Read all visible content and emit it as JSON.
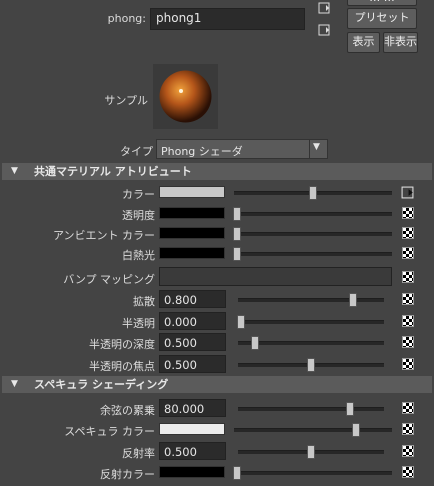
{
  "header": {
    "node_label": "phong:",
    "node_name": "phong1",
    "preset_button": "プリセット",
    "top_button_partial": "… …",
    "show_button": "表示",
    "hide_button": "非表示"
  },
  "sample": {
    "label": "サンプル"
  },
  "type": {
    "label": "タイプ",
    "value": "Phong シェーダ"
  },
  "common_section": {
    "title": "共通マテリアル アトリビュート",
    "rows": [
      {
        "label": "カラー",
        "kind": "color",
        "swatch": "#c9c9c9",
        "slider": 0.5
      },
      {
        "label": "透明度",
        "kind": "color",
        "swatch": "#000000",
        "slider": 0.0
      },
      {
        "label": "アンビエント カラー",
        "kind": "color",
        "swatch": "#000000",
        "slider": 0.0
      },
      {
        "label": "白熱光",
        "kind": "color",
        "swatch": "#000000",
        "slider": 0.0
      },
      {
        "label": "バンプ マッピング",
        "kind": "bump"
      },
      {
        "label": "拡散",
        "kind": "num",
        "value": "0.800",
        "slider": 0.8
      },
      {
        "label": "半透明",
        "kind": "num",
        "value": "0.000",
        "slider": 0.0
      },
      {
        "label": "半透明の深度",
        "kind": "num",
        "value": "0.500",
        "slider": 0.1
      },
      {
        "label": "半透明の焦点",
        "kind": "num",
        "value": "0.500",
        "slider": 0.5
      }
    ]
  },
  "specular_section": {
    "title": "スペキュラ シェーディング",
    "rows": [
      {
        "label": "余弦の累乗",
        "kind": "num",
        "value": "80.000",
        "slider": 0.78
      },
      {
        "label": "スペキュラ カラー",
        "kind": "color",
        "swatch": "#ececec",
        "slider": 0.78
      },
      {
        "label": "反射率",
        "kind": "num",
        "value": "0.500",
        "slider": 0.5
      },
      {
        "label": "反射カラー",
        "kind": "color",
        "swatch": "#000000",
        "slider": 0.0
      }
    ]
  },
  "icons": {
    "section_toggle": "triangle-down-icon",
    "map_button": "checker-map-icon",
    "connection": "output-connection-icon"
  }
}
